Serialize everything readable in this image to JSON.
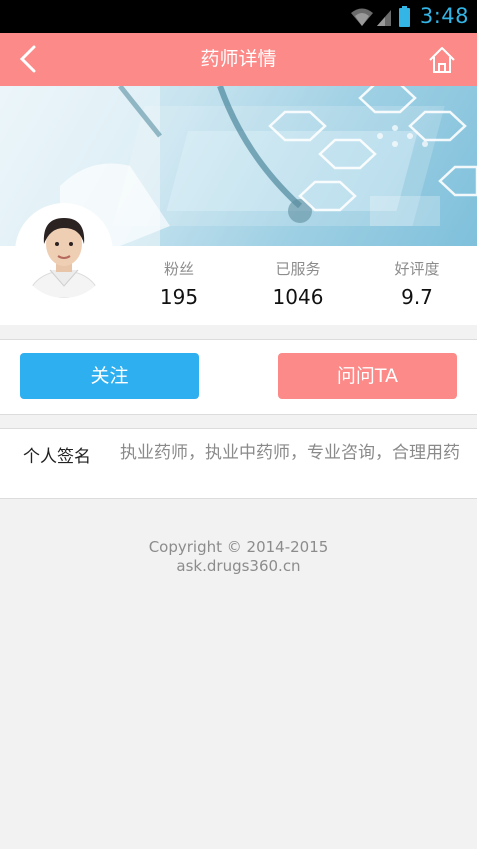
{
  "status_bar": {
    "time": "3:48",
    "icons": [
      "wifi-icon",
      "signal-icon",
      "battery-icon"
    ]
  },
  "header": {
    "title": "药师详情",
    "back_icon": "chevron-left-icon",
    "home_icon": "home-icon"
  },
  "profile": {
    "stats": [
      {
        "label": "粉丝",
        "value": "195"
      },
      {
        "label": "已服务",
        "value": "1046"
      },
      {
        "label": "好评度",
        "value": "9.7"
      }
    ]
  },
  "actions": {
    "follow_label": "关注",
    "ask_label": "问问TA"
  },
  "signature": {
    "label": "个人签名",
    "text": "执业药师，执业中药师，专业咨询，合理用药"
  },
  "footer": {
    "copyright": "Copyright © 2014-2015",
    "site": "ask.drugs360.cn"
  },
  "colors": {
    "header": "#fb8a88",
    "follow_button": "#2eaff0",
    "ask_button": "#fb8a88",
    "status_time": "#33b5e5"
  }
}
